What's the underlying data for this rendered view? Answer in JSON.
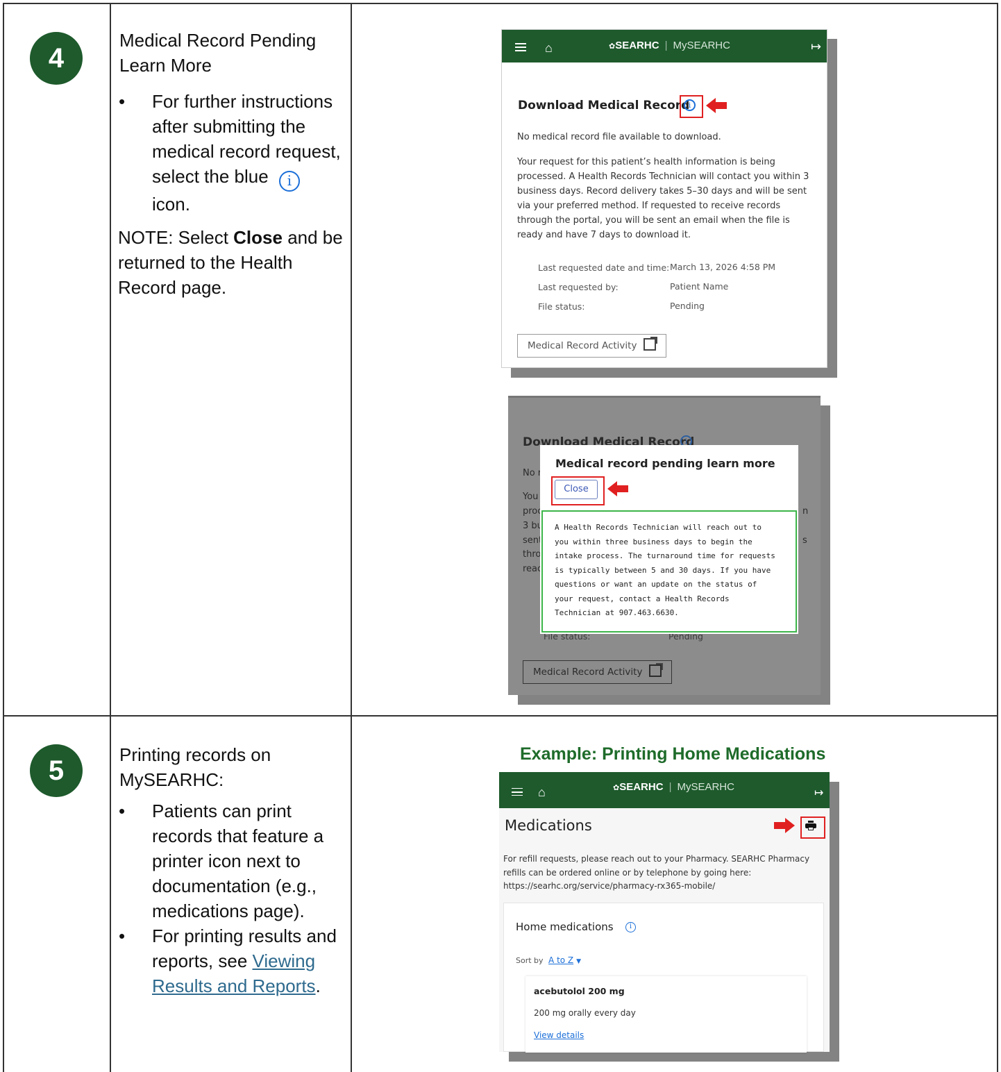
{
  "step4": {
    "number": "4",
    "title": "Medical Record Pending\nLearn More",
    "bullet_pre": "For further instructions after submitting the medical record request, select the blue",
    "bullet_post": "icon.",
    "note_pre": "NOTE: Select ",
    "note_bold": "Close",
    "note_post": " and be returned to the Health Record page."
  },
  "step5": {
    "number": "5",
    "title": "Printing records on\nMySEARHC:",
    "bullet1": "Patients can print records that feature a printer icon next to documentation (e.g., medications page).",
    "bullet2_pre": "For printing results and reports, see ",
    "bullet2_link": "Viewing Results and Reports",
    "bullet2_post": ".",
    "example_heading": "Example: Printing Home Medications"
  },
  "app": {
    "brand": "SEARHC",
    "brand_sep": "|",
    "portal": "MySEARHC"
  },
  "shot1": {
    "heading": "Download Medical Record",
    "no_file": "No medical record file available to download.",
    "body": "Your request for this patient’s health information is being processed. A Health Records Technician will contact you within 3 business days. Record delivery takes 5–30 days and will be sent via your preferred method. If requested to receive records through the portal, you will be sent an email when the file is ready and have 7 days to download it.",
    "rows": [
      {
        "label": "Last requested date and time:",
        "value": "March 13, 2026 4:58 PM"
      },
      {
        "label": "Last requested by:",
        "value": "Patient Name"
      },
      {
        "label": "File status:",
        "value": "Pending"
      }
    ],
    "activity_button": "Medical Record Activity"
  },
  "shot2": {
    "bg_heading": "Download Medical Record",
    "bg_frag": [
      "No r",
      "You",
      "proc",
      "3 bu",
      "sent",
      "thro",
      "reac"
    ],
    "bg_right_frag": [
      "n",
      "s"
    ],
    "bg_file_status": "File status:",
    "bg_pending": "Pending",
    "modal_title": "Medical record pending learn more",
    "close_button": "Close",
    "modal_body": "A Health Records Technician will reach out to you within three business days to begin the intake process. The turnaround time for requests is typically between 5 and 30 days. If you have questions or want an update on the status of your request, contact a Health Records Technician at 907.463.6630.",
    "activity_button": "Medical Record Activity"
  },
  "shot3": {
    "page_title": "Medications",
    "refill_note": "For refill requests, please reach out to your Pharmacy. SEARHC Pharmacy refills can be ordered online or by telephone by going here: https://searhc.org/service/pharmacy-rx365-mobile/",
    "section_title": "Home medications",
    "sort_label": "Sort by",
    "sort_value": "A to Z",
    "med_name": "acebutolol 200 mg",
    "med_sig": "200 mg orally every day",
    "view_details": "View details"
  },
  "colors": {
    "brand_green": "#1e5a2c",
    "alert_red": "#e02020",
    "info_blue": "#1c6fd8",
    "modal_green_border": "#3cb54a",
    "link_teal": "#2e6a8e"
  }
}
